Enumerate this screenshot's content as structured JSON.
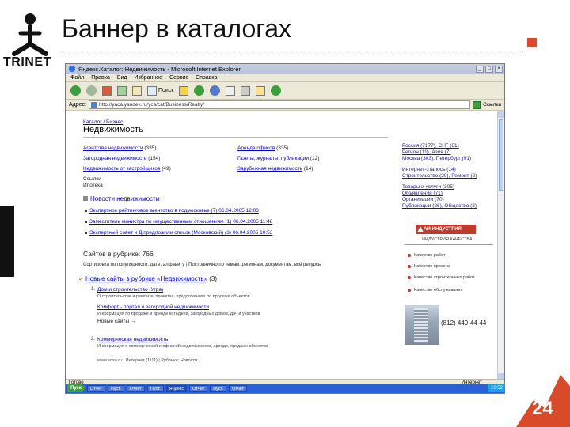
{
  "slide": {
    "logo_text": "TRINET",
    "title": "Баннер в каталогах",
    "page_number": "24",
    "colors": {
      "accent": "#d94a2b",
      "dark": "#111111"
    }
  },
  "browser": {
    "title": "Яндекс.Каталог: Недвижимость - Microsoft Internet Explorer",
    "window_buttons": [
      "_",
      "□",
      "×"
    ],
    "menu": [
      "Файл",
      "Правка",
      "Вид",
      "Избранное",
      "Сервис",
      "Справка"
    ],
    "toolbar": {
      "search_label": "Поиск"
    },
    "address_label": "Адрес:",
    "address_value": "http://yaca.yandex.ru/yca/cat/Business/Realty/",
    "links_label": "Ссылки",
    "status_text": "Готово",
    "status_zone": "Интернет"
  },
  "page": {
    "breadcrumbs": "Каталог / Бизнес",
    "heading": "Недвижимость",
    "categories_left": [
      {
        "label": "Агентства недвижимости",
        "count": "(335)"
      },
      {
        "label": "Загородная недвижимость",
        "count": "(154)"
      },
      {
        "label": "Недвижимость от застройщиков",
        "count": "(49)"
      }
    ],
    "categories_left_extra": [
      "Ссылки",
      "Ипотека"
    ],
    "categories_right": [
      {
        "label": "Аренда офисов",
        "count": "(335)"
      },
      {
        "label": "Газеты, журналы, публикации",
        "count": "(12)"
      },
      {
        "label": "Зарубежная недвижимость",
        "count": "(14)"
      }
    ],
    "regions": [
      "Россия (7177), СНГ (61)",
      "Регион (11), Азия (7)",
      "Москва (303), Петербург (91)",
      "Интернет-сталось (14)",
      "Строительство (29), Ремонт (2)",
      "Товары и услуги (305)",
      "Объявления (71)",
      "Организации (70)",
      "Публикации (26), Общество (2)"
    ],
    "news_heading": "Новости недвижимости",
    "news": [
      "Экспертное рейтинговое агентство в подмосковье (7) 06.04.2005 12:03",
      "Заместитель министра по имущественным отношениям (1) 06.04.2005 11:48",
      "Экспертный совет и Д предложили список (Московский) (3) 06.04.2005 10:53"
    ],
    "sites_count": "Сайтов в рубрике: 766",
    "sort_line": "Сортировка по популярности, дате, алфавиту  |  Постранично по темам, регионам, документам, всё ресурсы",
    "new_sites_heading": "Новые сайты в рубрике «Недвижимость»",
    "new_sites_count": "(3)",
    "entries": [
      {
        "num": "1.",
        "title": "Дом и строительство (Угра)",
        "text": "О строительстве и ремонте, проектах, предложениях по продаже объектов"
      },
      {
        "num": "",
        "title": "Комфорт - портал о загородной недвижимости",
        "text": "Информация по продаже и аренде котеджей, загородных домов, дач и участков"
      },
      {
        "num": "",
        "title": "Новые сайты →",
        "text": ""
      },
      {
        "num": "2.",
        "title": "Коммерческая недвижимость",
        "text": "Информация о коммерческой и офисной недвижимости, аренде, продаже объектов"
      },
      {
        "num": "",
        "title": "",
        "text": "www.sdsa.ru | Интернет (1111) | Рубрика: Новости"
      }
    ],
    "ad": {
      "brand": "АИ-ИНДУСТРИЯ",
      "slogan": "ИНДУСТРИЯ КАЧЕСТВА",
      "items": [
        "Качество работ",
        "Качество проекта",
        "Качество строительных работ",
        "Качество обслуживания"
      ],
      "phone": "(812) 449-44-44"
    }
  },
  "taskbar": {
    "start": "Пуск",
    "tasks": [
      "Отчет",
      "Пуст.",
      "Отчет",
      "Пуст.",
      "Яндекс",
      "Отчет",
      "Пуст.",
      "Отчет"
    ],
    "clock": "10:52"
  }
}
